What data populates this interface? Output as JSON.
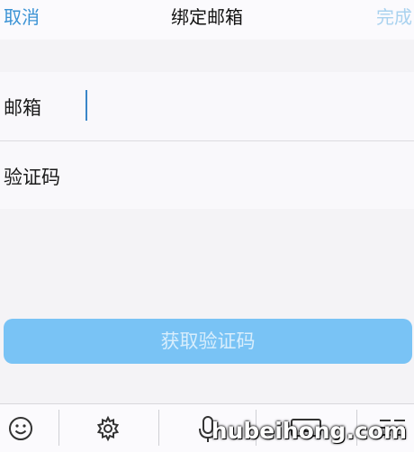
{
  "nav": {
    "cancel_label": "取消",
    "title": "绑定邮箱",
    "done_label": "完成"
  },
  "form": {
    "email_label": "邮箱",
    "email_value": "",
    "code_label": "验证码",
    "code_value": ""
  },
  "verify_button_label": "获取验证码",
  "keyboard_toolbar": {
    "icons": [
      "emoji-icon",
      "gear-icon",
      "microphone-icon",
      "keyboard-icon",
      "menu-icon"
    ]
  },
  "watermark": "hubeihong.com",
  "colors": {
    "accent": "#3b93d5",
    "done_disabled": "#a9d2ef",
    "button_bg": "#79c3f5",
    "button_text": "#d9eefc"
  }
}
